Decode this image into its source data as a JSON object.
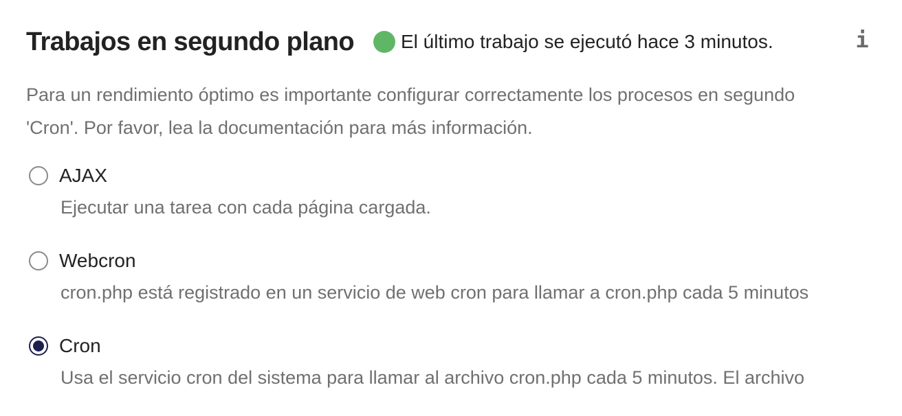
{
  "header": {
    "title": "Trabajos en segundo plano",
    "status_text": "El último trabajo se ejecutó hace 3 minutos.",
    "status_color": "#5fb766",
    "info_icon": "info-icon",
    "info_glyph": "i"
  },
  "description": {
    "line1": "Para un rendimiento óptimo es importante configurar correctamente los procesos en segundo",
    "line2": "'Cron'. Por favor, lea la documentación para más información."
  },
  "options": [
    {
      "label": "AJAX",
      "description": "Ejecutar una tarea con cada página cargada.",
      "checked": false
    },
    {
      "label": "Webcron",
      "description": "cron.php está registrado en un servicio de web cron para llamar a cron.php cada 5 minutos",
      "checked": false
    },
    {
      "label": "Cron",
      "description": "Usa el servicio cron del sistema para llamar al archivo cron.php cada 5 minutos. El archivo",
      "checked": true
    }
  ],
  "colors": {
    "radio_checked": "#1f1f4f",
    "muted_text": "#707070"
  }
}
